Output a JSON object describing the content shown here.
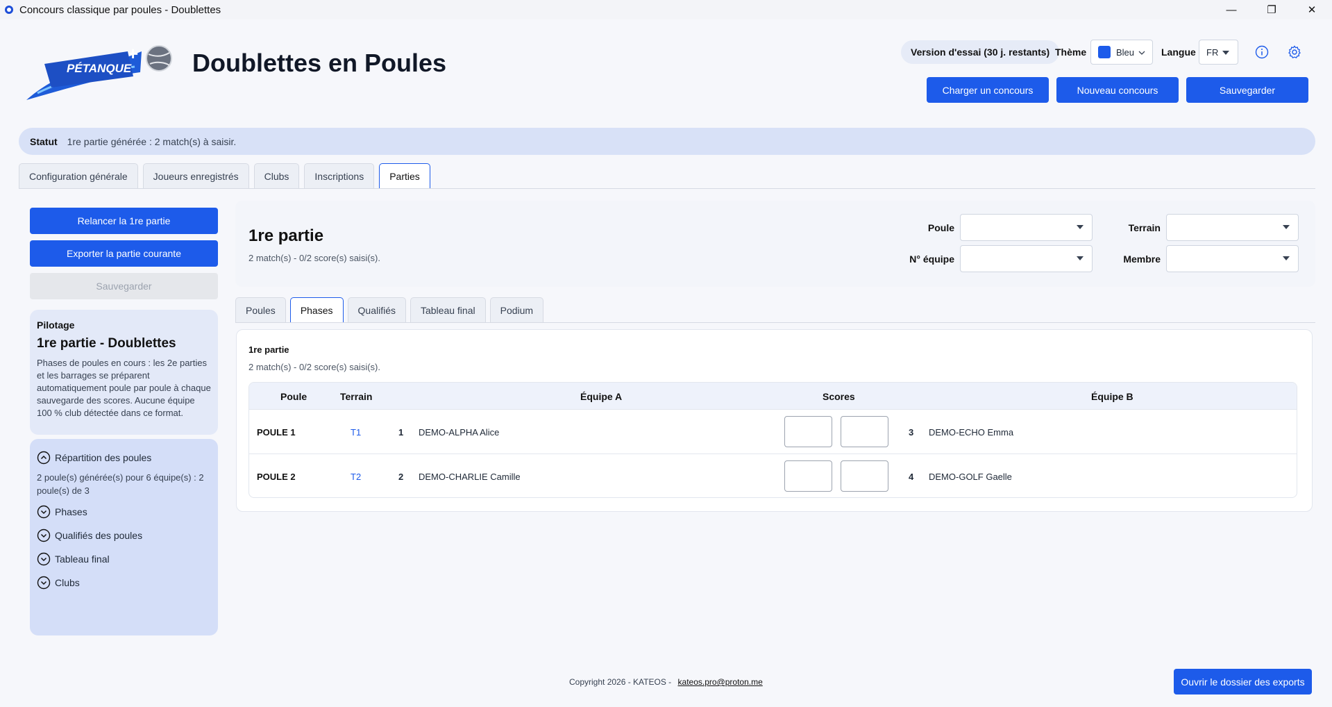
{
  "window": {
    "title": "Concours classique par poules - Doublettes",
    "minimize": "—",
    "maximize": "❐",
    "close": "✕"
  },
  "header": {
    "logo_text": "PÉTANQUE",
    "title": "Doublettes en Poules",
    "trial": "Version d'essai (30 j. restants)",
    "theme_label": "Thème",
    "theme_value": "Bleu",
    "theme_color": "#1d5bea",
    "lang_label": "Langue",
    "lang_value": "FR",
    "buttons": {
      "load": "Charger un concours",
      "new": "Nouveau concours",
      "save": "Sauvegarder"
    }
  },
  "status": {
    "label": "Statut",
    "value": "1re partie générée : 2 match(s) à saisir."
  },
  "main_tabs": [
    {
      "label": "Configuration générale",
      "active": false
    },
    {
      "label": "Joueurs enregistrés",
      "active": false
    },
    {
      "label": "Clubs",
      "active": false
    },
    {
      "label": "Inscriptions",
      "active": false
    },
    {
      "label": "Parties",
      "active": true
    }
  ],
  "left": {
    "relaunch": "Relancer la 1re partie",
    "export": "Exporter la partie courante",
    "save": "Sauvegarder",
    "pilot_caption": "Pilotage",
    "pilot_title": "1re partie - Doublettes",
    "pilot_desc": "Phases de poules en cours : les 2e parties et les barrages se préparent automatiquement poule par poule à chaque sauvegarde des scores. Aucune équipe 100 % club détectée dans ce format.",
    "accordion": [
      {
        "label": "Répartition des poules",
        "expanded": true,
        "desc": "2 poule(s) générée(s) pour 6 équipe(s) : 2 poule(s) de 3"
      },
      {
        "label": "Phases",
        "expanded": false
      },
      {
        "label": "Qualifiés des poules",
        "expanded": false
      },
      {
        "label": "Tableau final",
        "expanded": false
      },
      {
        "label": "Clubs",
        "expanded": false
      }
    ]
  },
  "parties": {
    "title": "1re partie",
    "subtitle": "2 match(s) - 0/2 score(s) saisi(s).",
    "filters": {
      "poule": "Poule",
      "terrain": "Terrain",
      "equipe": "N° équipe",
      "membre": "Membre"
    }
  },
  "sub_tabs": [
    {
      "label": "Poules",
      "active": false
    },
    {
      "label": "Phases",
      "active": true
    },
    {
      "label": "Qualifiés",
      "active": false
    },
    {
      "label": "Tableau final",
      "active": false
    },
    {
      "label": "Podium",
      "active": false
    }
  ],
  "phase": {
    "title": "1re partie",
    "subtitle": "2 match(s) - 0/2 score(s) saisi(s).",
    "columns": {
      "poule": "Poule",
      "terrain": "Terrain",
      "team_a": "Équipe A",
      "scores": "Scores",
      "team_b": "Équipe B"
    },
    "rows": [
      {
        "poule": "POULE 1",
        "terrain": "T1",
        "num_a": "1",
        "team_a": "DEMO-ALPHA Alice",
        "score_a": "",
        "score_b": "",
        "num_b": "3",
        "team_b": "DEMO-ECHO Emma"
      },
      {
        "poule": "POULE 2",
        "terrain": "T2",
        "num_a": "2",
        "team_a": "DEMO-CHARLIE Camille",
        "score_a": "",
        "score_b": "",
        "num_b": "4",
        "team_b": "DEMO-GOLF Gaelle"
      }
    ]
  },
  "footer": {
    "copyright": "Copyright 2026 - KATEOS -",
    "email": "kateos.pro@proton.me",
    "open_exports": "Ouvrir le dossier des exports"
  }
}
